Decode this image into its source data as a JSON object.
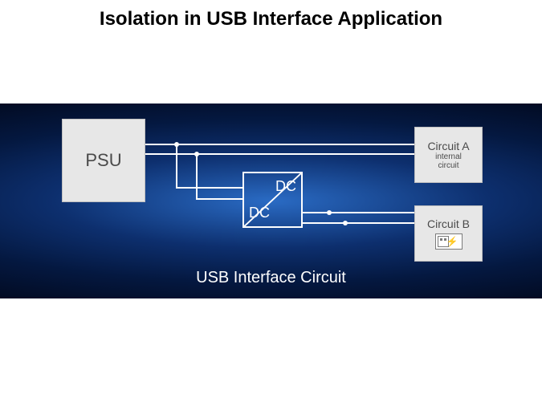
{
  "title": "Isolation in USB Interface Application",
  "diagram": {
    "psu_label": "PSU",
    "dcdc_top": "DC",
    "dcdc_bottom": "DC",
    "circuit_a": {
      "line1": "Circuit A",
      "line2a": "internal",
      "line2b": "circuit"
    },
    "circuit_b": {
      "line1": "Circuit B"
    },
    "caption": "USB Interface Circuit"
  }
}
